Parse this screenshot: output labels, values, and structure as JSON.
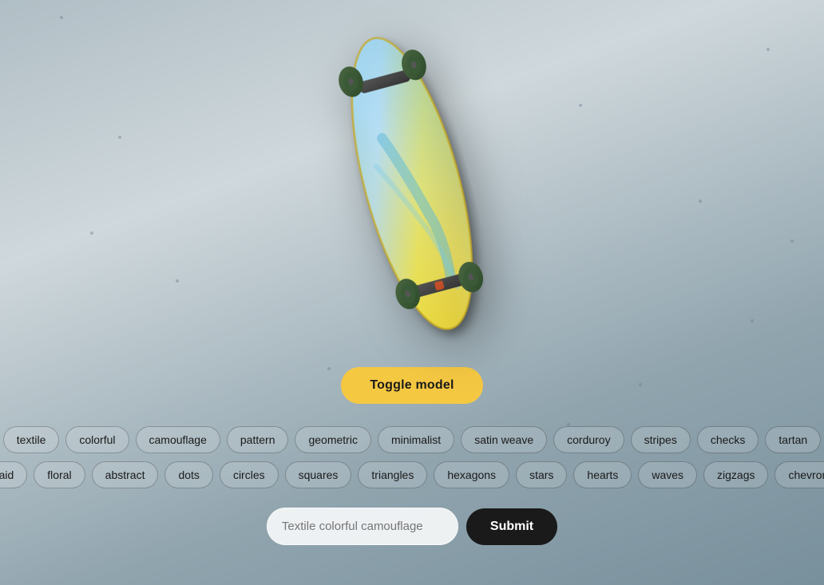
{
  "toggle_button": {
    "label": "Toggle model"
  },
  "submit_button": {
    "label": "Submit"
  },
  "input": {
    "placeholder": "Textile colorful camouflage",
    "value": ""
  },
  "tags_row1": [
    "textile",
    "colorful",
    "camouflage",
    "pattern",
    "geometric",
    "minimalist",
    "satin weave",
    "corduroy",
    "stripes",
    "checks",
    "tartan"
  ],
  "tags_row2": [
    "plaid",
    "floral",
    "abstract",
    "dots",
    "circles",
    "squares",
    "triangles",
    "hexagons",
    "stars",
    "hearts",
    "waves",
    "zigzags",
    "chevrons"
  ],
  "dots": [
    {
      "top": "20",
      "left": "75"
    },
    {
      "top": "170",
      "left": "148"
    },
    {
      "top": "290",
      "left": "113"
    },
    {
      "top": "130",
      "left": "725"
    },
    {
      "top": "60",
      "left": "960"
    },
    {
      "top": "300",
      "left": "990"
    },
    {
      "top": "460",
      "left": "410"
    },
    {
      "top": "530",
      "left": "710"
    },
    {
      "top": "480",
      "left": "800"
    },
    {
      "top": "250",
      "left": "875"
    },
    {
      "top": "400",
      "left": "940"
    },
    {
      "top": "350",
      "left": "220"
    }
  ]
}
